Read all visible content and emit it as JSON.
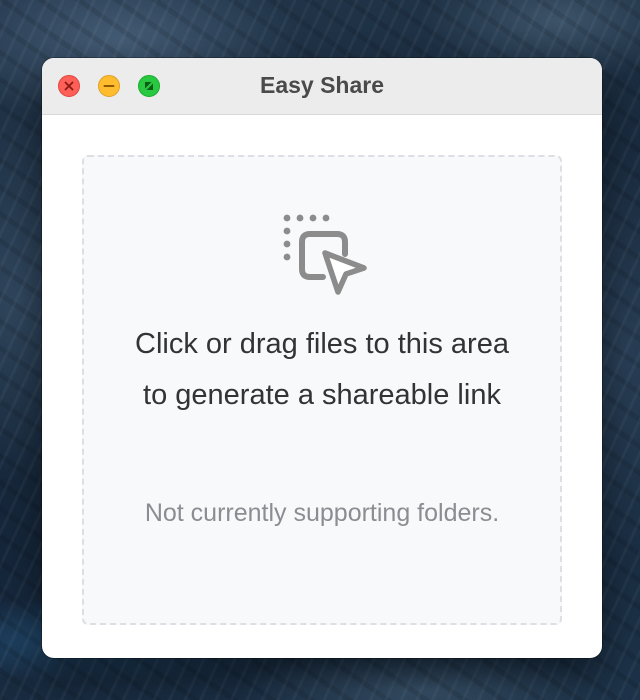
{
  "window": {
    "title": "Easy Share",
    "controls": {
      "close_icon": "close-icon",
      "minimize_icon": "minimize-icon",
      "fullscreen_icon": "fullscreen-icon",
      "close_color": "#fe5f57",
      "minimize_color": "#febc2e",
      "fullscreen_color": "#28c840"
    }
  },
  "dropzone": {
    "icon": "drag-drop-cursor-icon",
    "primary_text": "Click or drag files to this area to generate a shareable link",
    "secondary_text": "Not currently supporting folders.",
    "border_color": "#dcdfe3",
    "background_color": "#f8f9fb"
  }
}
